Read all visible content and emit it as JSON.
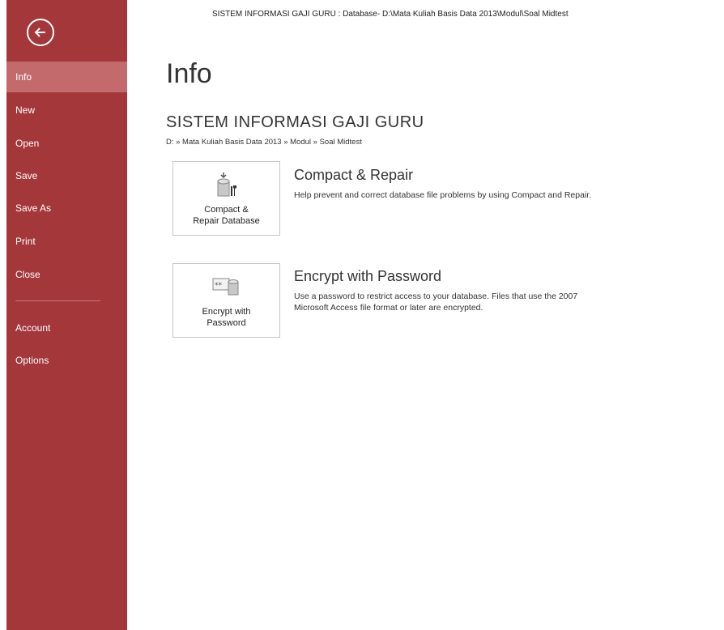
{
  "window": {
    "title": "SISTEM INFORMASI GAJI GURU : Database- D:\\Mata Kuliah Basis Data 2013\\Modul\\Soal Midtest"
  },
  "sidebar": {
    "items": [
      {
        "label": "Info"
      },
      {
        "label": "New"
      },
      {
        "label": "Open"
      },
      {
        "label": "Save"
      },
      {
        "label": "Save As"
      },
      {
        "label": "Print"
      },
      {
        "label": "Close"
      },
      {
        "label": "Account"
      },
      {
        "label": "Options"
      }
    ],
    "active": "Info",
    "back_icon": "back-arrow-icon"
  },
  "main": {
    "title": "Info",
    "db_name": "SISTEM INFORMASI GAJI GURU",
    "db_path": "D: » Mata Kuliah Basis Data 2013 » Modul » Soal Midtest",
    "sections": [
      {
        "tile_label": "Compact &\nRepair Database",
        "title": "Compact & Repair",
        "description": "Help prevent and correct database file problems by using Compact and Repair.",
        "icon": "compact-repair-icon"
      },
      {
        "tile_label": "Encrypt with\nPassword",
        "title": "Encrypt with Password",
        "description": "Use a password to restrict access to your database. Files that use the 2007\nMicrosoft Access file format or later are encrypted.",
        "icon": "encrypt-icon"
      }
    ]
  },
  "colors": {
    "sidebar": "#a4373a",
    "sidebar_active": "#c36a6c",
    "text": "#333333"
  }
}
